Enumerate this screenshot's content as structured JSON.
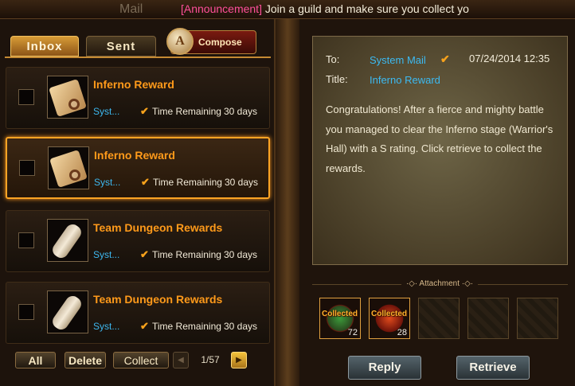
{
  "header": {
    "title": "Mail",
    "announcement_tag": "[Announcement]",
    "announcement_text": " Join a guild and make sure you collect yo"
  },
  "tabs": {
    "inbox": "Inbox",
    "sent": "Sent",
    "compose": "Compose",
    "compose_icon": "A"
  },
  "mails": [
    {
      "title": "Inferno Reward",
      "sender": "Syst...",
      "time_label": "Time Remaining",
      "days": "30 days",
      "icon": "scroll-magnifier-icon",
      "selected": false
    },
    {
      "title": "Inferno Reward",
      "sender": "Syst...",
      "time_label": "Time Remaining",
      "days": "30 days",
      "icon": "scroll-magnifier-icon",
      "selected": true
    },
    {
      "title": "Team Dungeon Rewards",
      "sender": "Syst...",
      "time_label": "Time Remaining",
      "days": "30 days",
      "icon": "rolled-scroll-icon",
      "selected": false
    },
    {
      "title": "Team Dungeon Rewards",
      "sender": "Syst...",
      "time_label": "Time Remaining",
      "days": "30 days",
      "icon": "rolled-scroll-icon",
      "selected": false
    }
  ],
  "footer": {
    "all": "All",
    "delete": "Delete",
    "collect": "Collect",
    "page": "1/57"
  },
  "detail": {
    "to_label": "To:",
    "title_label": "Title:",
    "to": "System Mail",
    "date": "07/24/2014 12:35",
    "title": "Inferno Reward",
    "body": "Congratulations! After a fierce and mighty battle you managed to clear the Inferno stage (Warrior's Hall) with a S rating. Click retrieve to collect the rewards."
  },
  "attachment": {
    "label": "·◇· Attachment ·◇·",
    "items": [
      {
        "status": "Collected",
        "count": "72",
        "icon": "green-emblem-icon"
      },
      {
        "status": "Collected",
        "count": "28",
        "icon": "red-emblem-icon"
      }
    ],
    "empty_slots": 3
  },
  "buttons": {
    "reply": "Reply",
    "retrieve": "Retrieve"
  },
  "colors": {
    "accent_orange": "#ff9a1a",
    "link_blue": "#3cbaf2",
    "selection_border": "#ffa424"
  }
}
